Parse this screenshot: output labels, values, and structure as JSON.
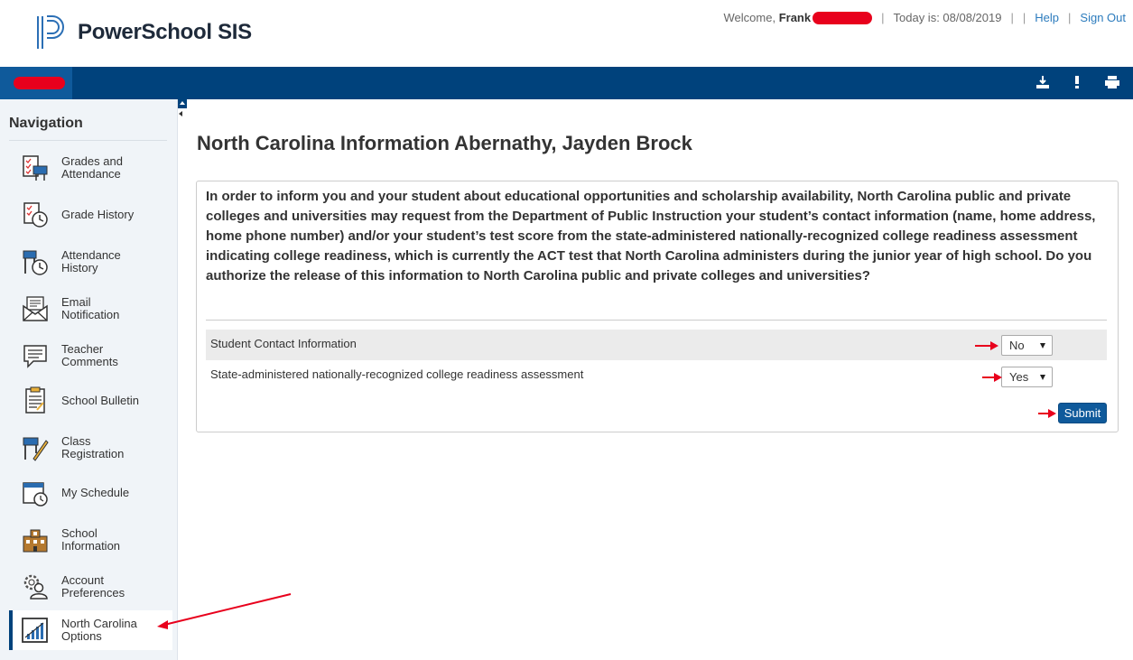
{
  "header": {
    "app_title": "PowerSchool SIS",
    "welcome_prefix": "Welcome,",
    "user_name": "Frank",
    "today_label": "Today is: 08/08/2019",
    "separator": "|",
    "help_link": "Help",
    "signout_link": "Sign Out"
  },
  "toolbar": {
    "icons": [
      "download-icon",
      "alert-icon",
      "print-icon"
    ]
  },
  "sidebar": {
    "title": "Navigation",
    "items": [
      {
        "label": "Grades and Attendance",
        "icon": "grades-attendance-icon"
      },
      {
        "label": "Grade History",
        "icon": "grade-history-icon"
      },
      {
        "label": "Attendance History",
        "icon": "attendance-history-icon"
      },
      {
        "label": "Email Notification",
        "icon": "email-notification-icon"
      },
      {
        "label": "Teacher Comments",
        "icon": "teacher-comments-icon"
      },
      {
        "label": "School Bulletin",
        "icon": "school-bulletin-icon"
      },
      {
        "label": "Class Registration",
        "icon": "class-registration-icon"
      },
      {
        "label": "My Schedule",
        "icon": "my-schedule-icon"
      },
      {
        "label": "School Information",
        "icon": "school-information-icon"
      },
      {
        "label": "Account Preferences",
        "icon": "account-preferences-icon"
      },
      {
        "label": "North Carolina Options",
        "icon": "north-carolina-options-icon",
        "active": true
      }
    ]
  },
  "main": {
    "title": "North Carolina Information Abernathy, Jayden Brock",
    "question": "In order to inform you and your student about educational opportunities and scholarship availability, North Carolina public and private colleges and universities may request from the Department of Public Instruction your student’s contact information (name, home address, home phone number) and/or your student’s test score from the state-administered nationally-recognized college readiness assessment indicating college readiness, which is currently the ACT test that North Carolina administers during the junior year of high school. Do you authorize the release of this information to North Carolina public and private colleges and universities?",
    "rows": [
      {
        "label": "Student Contact Information",
        "value": "No"
      },
      {
        "label": "State-administered nationally-recognized college readiness assessment",
        "value": "Yes"
      }
    ],
    "submit_label": "Submit"
  },
  "colors": {
    "brand_blue": "#00427c",
    "annotation_red": "#e8001c",
    "link": "#2b7bbd"
  }
}
